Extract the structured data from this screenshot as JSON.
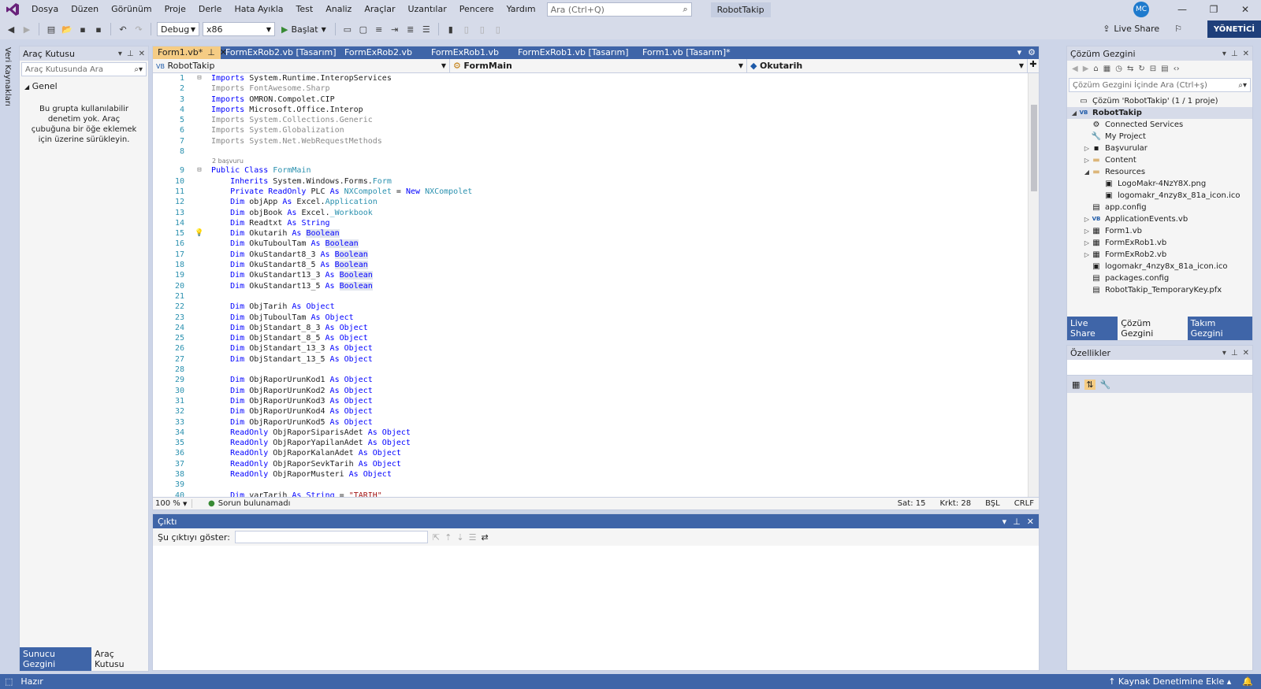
{
  "menu": {
    "items": [
      "Dosya",
      "Düzen",
      "Görünüm",
      "Proje",
      "Derle",
      "Hata Ayıkla",
      "Test",
      "Analiz",
      "Araçlar",
      "Uzantılar",
      "Pencere",
      "Yardım"
    ],
    "search_placeholder": "Ara (Ctrl+Q)",
    "app_title": "RobotTakip",
    "avatar_initials": "MC"
  },
  "toolbar": {
    "config": "Debug",
    "platform": "x86",
    "run_label": "Başlat",
    "live_share": "Live Share",
    "admin_label": "YÖNETİCİ"
  },
  "left_strip": {
    "label": "Veri Kaynakları"
  },
  "toolbox": {
    "title": "Araç Kutusu",
    "search_placeholder": "Araç Kutusunda Ara",
    "group": "Genel",
    "empty_message": "Bu grupta kullanılabilir denetim yok. Araç çubuğuna bir öğe eklemek için üzerine sürükleyin.",
    "bottom_tabs": [
      "Sunucu Gezgini",
      "Araç Kutusu"
    ]
  },
  "editor": {
    "tabs": [
      "Form1.vb*",
      "FormExRob2.vb [Tasarım]",
      "FormExRob2.vb",
      "FormExRob1.vb",
      "FormExRob1.vb [Tasarım]",
      "Form1.vb [Tasarım]*"
    ],
    "nav_project": "RobotTakip",
    "nav_class": "FormMain",
    "nav_member": "Okutarih",
    "references_hint": "2 başvuru",
    "lines": [
      {
        "n": "1",
        "t": "Imports System.Runtime.InteropServices"
      },
      {
        "n": "2",
        "t": "Imports FontAwesome.Sharp"
      },
      {
        "n": "3",
        "t": "Imports OMRON.Compolet.CIP"
      },
      {
        "n": "4",
        "t": "Imports Microsoft.Office.Interop"
      },
      {
        "n": "5",
        "t": "Imports System.Collections.Generic"
      },
      {
        "n": "6",
        "t": "Imports System.Globalization"
      },
      {
        "n": "7",
        "t": "Imports System.Net.WebRequestMethods"
      },
      {
        "n": "8",
        "t": ""
      },
      {
        "n": "9",
        "t": "Public Class FormMain"
      },
      {
        "n": "10",
        "t": "    Inherits System.Windows.Forms.Form"
      },
      {
        "n": "11",
        "t": "    Private ReadOnly PLC As NXCompolet = New NXCompolet"
      },
      {
        "n": "12",
        "t": "    Dim objApp As Excel.Application"
      },
      {
        "n": "13",
        "t": "    Dim objBook As Excel._Workbook"
      },
      {
        "n": "14",
        "t": "    Dim Readtxt As String"
      },
      {
        "n": "15",
        "t": "    Dim Okutarih As Boolean"
      },
      {
        "n": "16",
        "t": "    Dim OkuTuboulTam As Boolean"
      },
      {
        "n": "17",
        "t": "    Dim OkuStandart8_3 As Boolean"
      },
      {
        "n": "18",
        "t": "    Dim OkuStandart8_5 As Boolean"
      },
      {
        "n": "19",
        "t": "    Dim OkuStandart13_3 As Boolean"
      },
      {
        "n": "20",
        "t": "    Dim OkuStandart13_5 As Boolean"
      },
      {
        "n": "21",
        "t": ""
      },
      {
        "n": "22",
        "t": "    Dim ObjTarih As Object"
      },
      {
        "n": "23",
        "t": "    Dim ObjTuboulTam As Object"
      },
      {
        "n": "24",
        "t": "    Dim ObjStandart_8_3 As Object"
      },
      {
        "n": "25",
        "t": "    Dim ObjStandart_8_5 As Object"
      },
      {
        "n": "26",
        "t": "    Dim ObjStandart_13_3 As Object"
      },
      {
        "n": "27",
        "t": "    Dim ObjStandart_13_5 As Object"
      },
      {
        "n": "28",
        "t": ""
      },
      {
        "n": "29",
        "t": "    Dim ObjRaporUrunKod1 As Object"
      },
      {
        "n": "30",
        "t": "    Dim ObjRaporUrunKod2 As Object"
      },
      {
        "n": "31",
        "t": "    Dim ObjRaporUrunKod3 As Object"
      },
      {
        "n": "32",
        "t": "    Dim ObjRaporUrunKod4 As Object"
      },
      {
        "n": "33",
        "t": "    Dim ObjRaporUrunKod5 As Object"
      },
      {
        "n": "34",
        "t": "    ReadOnly ObjRaporSiparisAdet As Object"
      },
      {
        "n": "35",
        "t": "    ReadOnly ObjRaporYapilanAdet As Object"
      },
      {
        "n": "36",
        "t": "    ReadOnly ObjRaporKalanAdet As Object"
      },
      {
        "n": "37",
        "t": "    ReadOnly ObjRaporSevkTarih As Object"
      },
      {
        "n": "38",
        "t": "    ReadOnly ObjRaporMusteri As Object"
      },
      {
        "n": "39",
        "t": ""
      },
      {
        "n": "40",
        "t": "    Dim varTarih As String = \"TARIH\""
      }
    ],
    "zoom": "100 %",
    "no_issues": "Sorun bulunamadı",
    "line_pos": "Sat: 15",
    "char_pos": "Krkt: 28",
    "ins_mode": "BŞL",
    "eol": "CRLF"
  },
  "output": {
    "title": "Çıktı",
    "show_label": "Şu çıktıyı göster:"
  },
  "solution_explorer": {
    "title": "Çözüm Gezgini",
    "search_placeholder": "Çözüm Gezgini İçinde Ara (Ctrl+ş)",
    "items": [
      {
        "label": "Çözüm 'RobotTakip' (1 / 1 proje)",
        "level": 0,
        "arrow": "",
        "icon": "▭"
      },
      {
        "label": "RobotTakip",
        "level": 0,
        "arrow": "◢",
        "icon": "VB",
        "bold": true
      },
      {
        "label": "Connected Services",
        "level": 1,
        "arrow": "",
        "icon": "⚙"
      },
      {
        "label": "My Project",
        "level": 1,
        "arrow": "",
        "icon": "🔧"
      },
      {
        "label": "Başvurular",
        "level": 1,
        "arrow": "▷",
        "icon": "▪"
      },
      {
        "label": "Content",
        "level": 1,
        "arrow": "▷",
        "icon": "▬"
      },
      {
        "label": "Resources",
        "level": 1,
        "arrow": "◢",
        "icon": "▬"
      },
      {
        "label": "LogoMakr-4NzY8X.png",
        "level": 2,
        "arrow": "",
        "icon": "▣"
      },
      {
        "label": "logomakr_4nzy8x_81a_icon.ico",
        "level": 2,
        "arrow": "",
        "icon": "▣"
      },
      {
        "label": "app.config",
        "level": 1,
        "arrow": "",
        "icon": "▤"
      },
      {
        "label": "ApplicationEvents.vb",
        "level": 1,
        "arrow": "▷",
        "icon": "VB"
      },
      {
        "label": "Form1.vb",
        "level": 1,
        "arrow": "▷",
        "icon": "▦"
      },
      {
        "label": "FormExRob1.vb",
        "level": 1,
        "arrow": "▷",
        "icon": "▦"
      },
      {
        "label": "FormExRob2.vb",
        "level": 1,
        "arrow": "▷",
        "icon": "▦"
      },
      {
        "label": "logomakr_4nzy8x_81a_icon.ico",
        "level": 1,
        "arrow": "",
        "icon": "▣"
      },
      {
        "label": "packages.config",
        "level": 1,
        "arrow": "",
        "icon": "▤"
      },
      {
        "label": "RobotTakip_TemporaryKey.pfx",
        "level": 1,
        "arrow": "",
        "icon": "▤"
      }
    ],
    "bottom_tabs": [
      "Live Share",
      "Çözüm Gezgini",
      "Takım Gezgini"
    ]
  },
  "properties": {
    "title": "Özellikler"
  },
  "statusbar": {
    "ready": "Hazır",
    "source_control": "Kaynak Denetimine Ekle"
  }
}
